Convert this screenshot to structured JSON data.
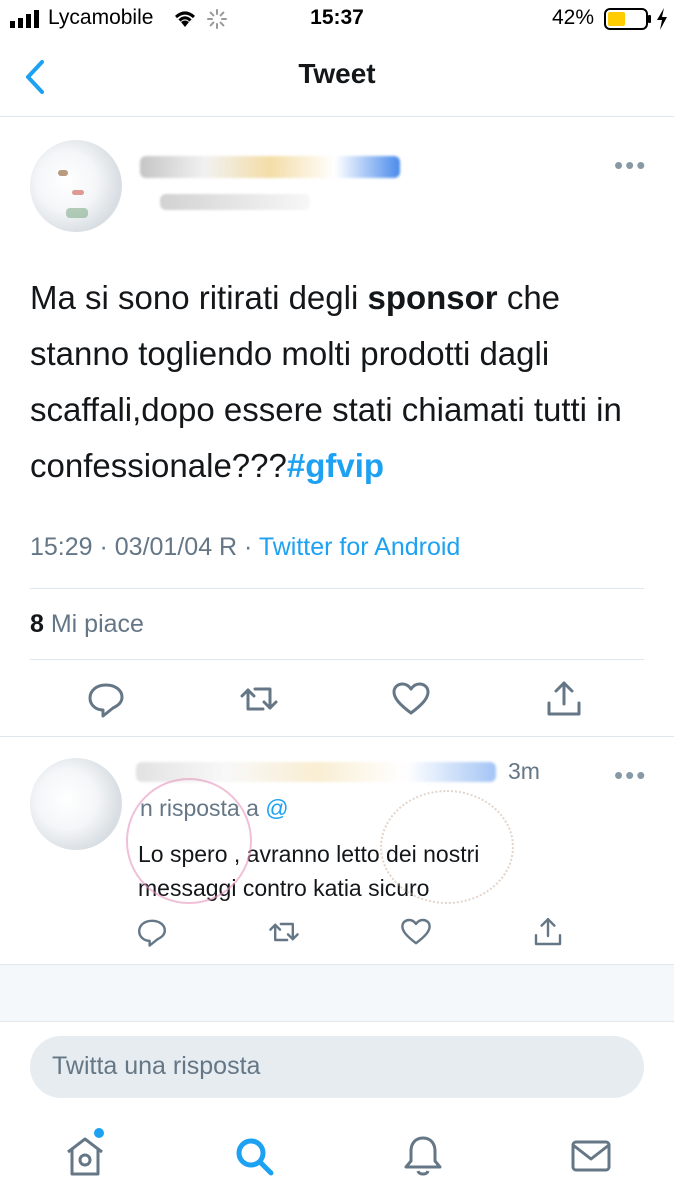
{
  "status_bar": {
    "carrier": "Lycamobile",
    "time": "15:37",
    "battery_percent": "42%"
  },
  "nav": {
    "title": "Tweet",
    "back_icon": "chevron-left-icon"
  },
  "tweet": {
    "text_part1": "Ma si sono ritirati degli ",
    "text_bold": "sponsor",
    "text_part2": " che stanno togliendo molti prodotti dagli scaffali,dopo essere stati chiamati tutti in confessionale???",
    "hashtag": "#gfvip",
    "timestamp": "15:29 · 03/01/04 R · ",
    "source": "Twitter for Android",
    "likes_count": "8",
    "likes_label": "Mi piace",
    "actions": [
      "reply-icon",
      "retweet-icon",
      "like-icon",
      "share-icon"
    ]
  },
  "reply": {
    "time": "3m",
    "in_reply_to": "n risposta a ",
    "in_reply_handle": "@",
    "text_line1": "Lo spero , avranno letto dei nostri",
    "text_line2": "messaggi contro katia sicuro"
  },
  "compose": {
    "placeholder": "Twitta una risposta"
  },
  "tabbar": {
    "items": [
      "home-icon",
      "search-icon",
      "notifications-icon",
      "messages-icon"
    ]
  },
  "colors": {
    "accent": "#1da1f2",
    "text": "#14171a",
    "secondary": "#657786",
    "divider": "#e1e8ed"
  }
}
